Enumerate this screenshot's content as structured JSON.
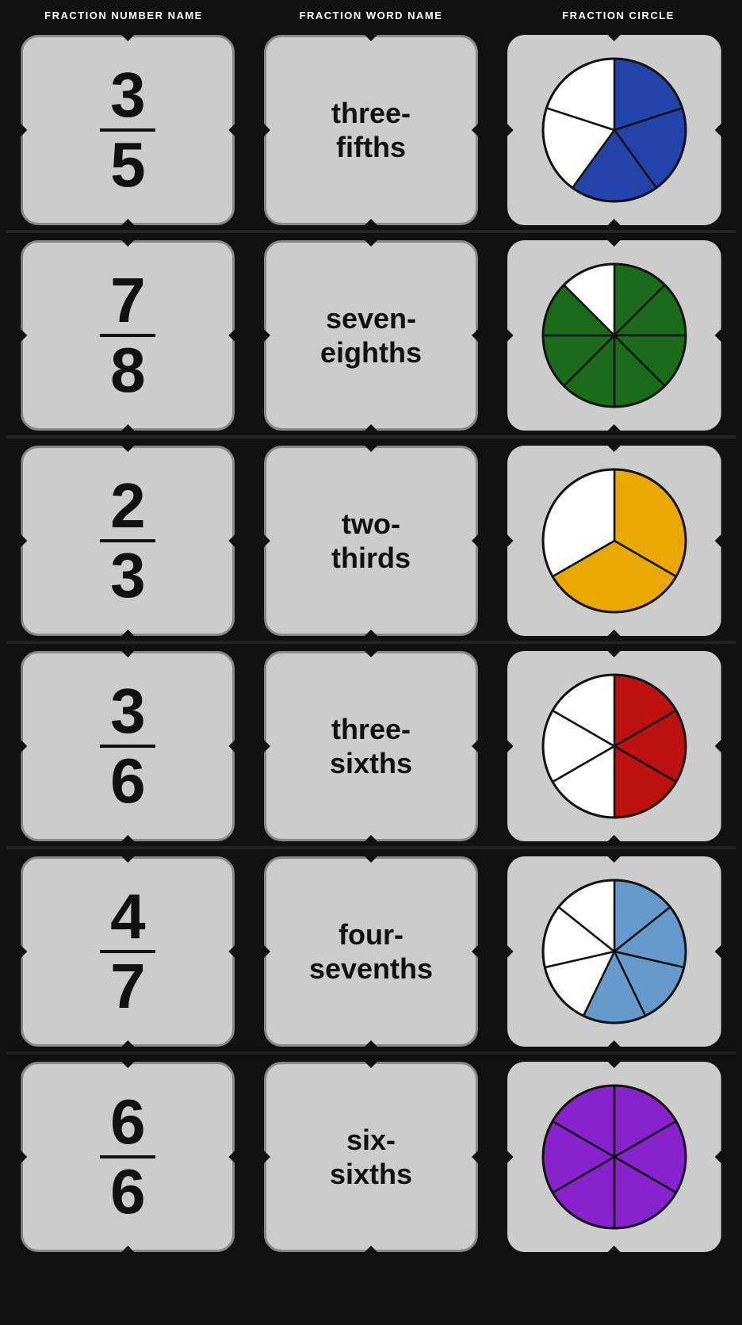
{
  "headers": {
    "col1": "FRACTION NUMBER NAME",
    "col2": "FRACTION WORD NAME",
    "col3": "FRACTION CIRCLE"
  },
  "rows": [
    {
      "numerator": "3",
      "denominator": "5",
      "word_line1": "three-",
      "word_line2": "fifths",
      "circle": {
        "slices": 5,
        "filled": 3,
        "color": "#2244aa",
        "bg_color": "white"
      }
    },
    {
      "numerator": "7",
      "denominator": "8",
      "word_line1": "seven-",
      "word_line2": "eighths",
      "circle": {
        "slices": 8,
        "filled": 7,
        "color": "#1a6b1a",
        "bg_color": "white"
      }
    },
    {
      "numerator": "2",
      "denominator": "3",
      "word_line1": "two-",
      "word_line2": "thirds",
      "circle": {
        "slices": 3,
        "filled": 2,
        "color": "#e8a800",
        "bg_color": "white"
      }
    },
    {
      "numerator": "3",
      "denominator": "6",
      "word_line1": "three-",
      "word_line2": "sixths",
      "circle": {
        "slices": 6,
        "filled": 3,
        "color": "#bb1111",
        "bg_color": "white"
      }
    },
    {
      "numerator": "4",
      "denominator": "7",
      "word_line1": "four-",
      "word_line2": "sevenths",
      "circle": {
        "slices": 7,
        "filled": 4,
        "color": "#6699cc",
        "bg_color": "white"
      }
    },
    {
      "numerator": "6",
      "denominator": "6",
      "word_line1": "six-",
      "word_line2": "sixths",
      "circle": {
        "slices": 6,
        "filled": 6,
        "color": "#8822cc",
        "bg_color": "white"
      }
    }
  ]
}
